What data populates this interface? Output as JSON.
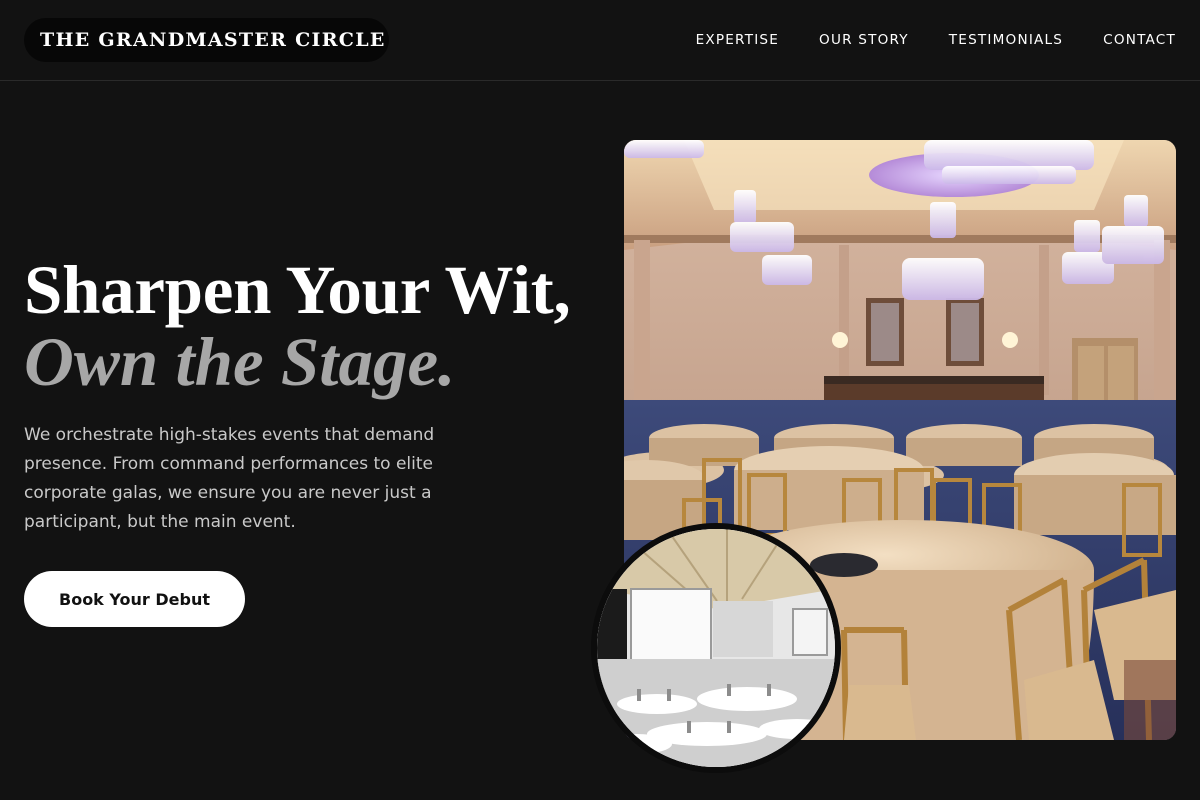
{
  "brand": {
    "logo_text": "THE GRANDMASTER CIRCLE"
  },
  "nav": {
    "items": [
      {
        "label": "EXPERTISE"
      },
      {
        "label": "OUR STORY"
      },
      {
        "label": "TESTIMONIALS"
      },
      {
        "label": "CONTACT"
      }
    ]
  },
  "hero": {
    "headline_line1": "Sharpen Your Wit,",
    "headline_line2": "Own the Stage.",
    "description": "We orchestrate high-stakes events that demand presence. From command performances to elite corporate galas, we ensure you are never just a participant, but the main event.",
    "cta_label": "Book Your Debut"
  },
  "images": {
    "main": "ballroom with chandeliers and round banquet tables",
    "inset": "conference hall with projection screens"
  },
  "colors": {
    "background": "#121212",
    "text_primary": "#ffffff",
    "text_muted": "#a7a7a7",
    "button_bg": "#ffffff",
    "button_text": "#111111"
  }
}
